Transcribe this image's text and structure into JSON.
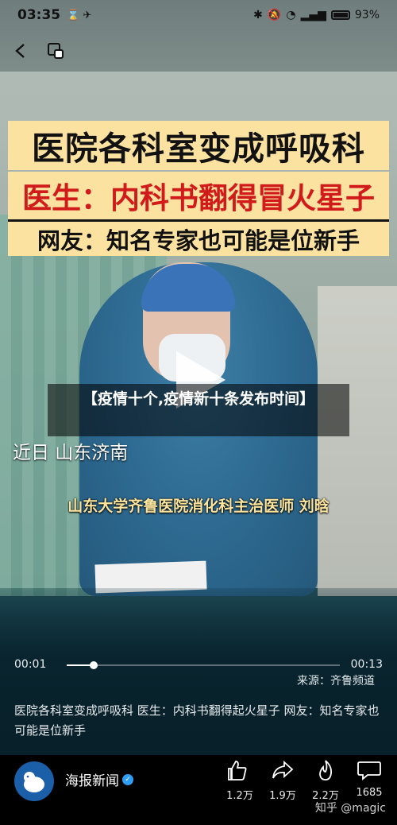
{
  "status_bar": {
    "time": "03:35",
    "battery": "93%"
  },
  "video": {
    "headline_line1": "医院各科室变成呼吸科",
    "headline_line2": "医生：内科书翻得冒火星子",
    "headline_line3": "网友：知名专家也可能是位新手",
    "overlay_title": "【疫情十个,疫情新十条发布时间】",
    "subtitle_location": "近日  山东济南",
    "subtitle_person": "山东大学齐鲁医院消化科主治医师  刘晗",
    "current_time": "00:01",
    "total_time": "00:13",
    "progress": 0.1,
    "source": "来源：齐鲁频道"
  },
  "description": "医院各科室变成呼吸科 医生：内科书翻得起火星子 网友：知名专家也可能是位新手",
  "author": {
    "name": "海报新闻"
  },
  "actions": [
    {
      "icon": "thumbs-up-icon",
      "count": "1.2万"
    },
    {
      "icon": "share-icon",
      "count": "1.9万"
    },
    {
      "icon": "flame-icon",
      "count": "2.2万"
    },
    {
      "icon": "comment-icon",
      "count": "1685"
    }
  ],
  "watermark": "知乎 @magic"
}
